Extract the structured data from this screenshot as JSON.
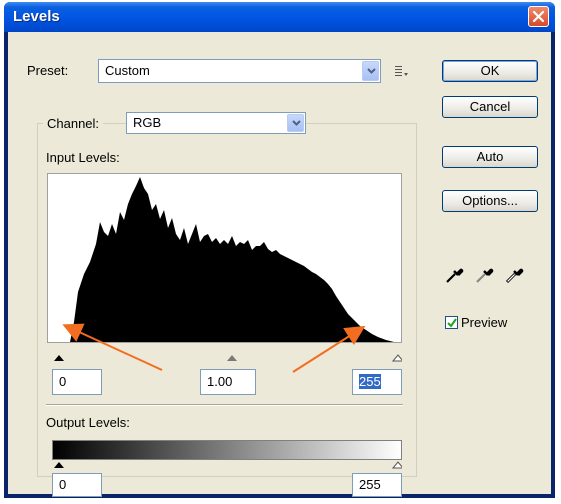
{
  "window": {
    "title": "Levels"
  },
  "preset": {
    "label": "Preset:",
    "value": "Custom"
  },
  "buttons": {
    "ok": "OK",
    "cancel": "Cancel",
    "auto": "Auto",
    "options": "Options..."
  },
  "channel": {
    "label": "Channel:",
    "value": "RGB"
  },
  "input_levels": {
    "label": "Input Levels:",
    "black": "0",
    "gamma": "1.00",
    "white": "255"
  },
  "output_levels": {
    "label": "Output Levels:",
    "black": "0",
    "white": "255"
  },
  "preview": {
    "label": "Preview",
    "checked": true
  },
  "icons": {
    "close": "close-icon",
    "dropdown": "chevron-down-icon",
    "preset_menu": "list-menu-icon",
    "eyedroppers": [
      "black-eyedropper-icon",
      "gray-eyedropper-icon",
      "white-eyedropper-icon"
    ]
  },
  "colors": {
    "title_bar": "#0054e3",
    "dialog_bg": "#ece9d8",
    "annotation_arrow": "#f26d1f",
    "selection": "#316ac5"
  }
}
